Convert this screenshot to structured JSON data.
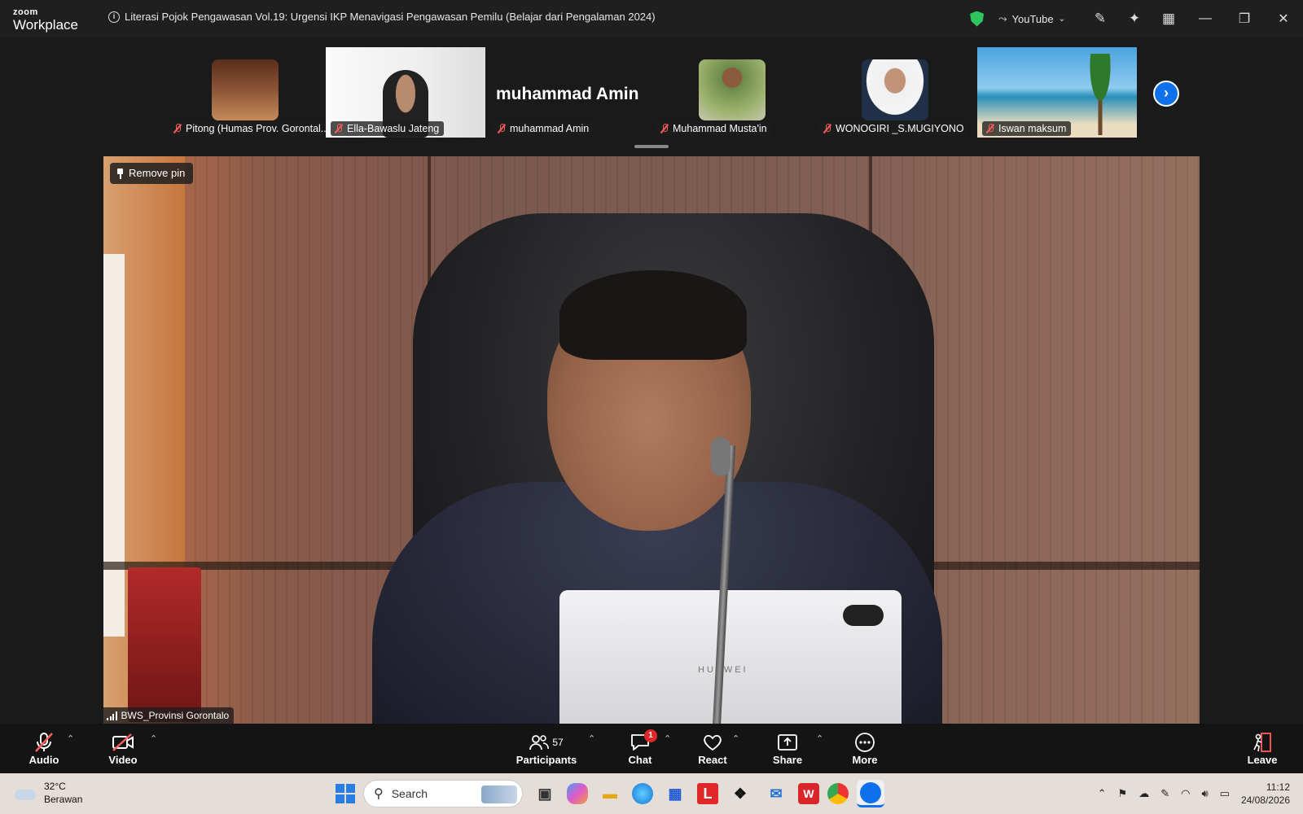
{
  "app": {
    "logo_small": "zoom",
    "logo_big": "Workplace"
  },
  "meeting": {
    "title": "Literasi Pojok Pengawasan Vol.19: Urgensi IKP Menavigasi Pengawasan Pemilu (Belajar  dari Pengalaman 2024)"
  },
  "titlebar": {
    "stream_label": "YouTube"
  },
  "participants_strip": [
    {
      "name": "Pitong (Humas Prov. Gorontal..."
    },
    {
      "name": "Ella-Bawaslu Jateng"
    },
    {
      "name": "muhammad Amin",
      "big_name": "muhammad Amin"
    },
    {
      "name": "Muhammad Musta'in"
    },
    {
      "name": "WONOGIRI _S.MUGIYONO"
    },
    {
      "name": "Iswan maksum"
    }
  ],
  "main_video": {
    "pin_label": "Remove pin",
    "speaker_name": "BWS_Provinsi Gorontalo",
    "device_brand": "HUAWEI"
  },
  "toolbar": {
    "audio": "Audio",
    "video": "Video",
    "participants": "Participants",
    "participants_count": "57",
    "chat": "Chat",
    "chat_badge": "1",
    "react": "React",
    "share": "Share",
    "more": "More",
    "leave": "Leave"
  },
  "taskbar": {
    "temperature": "32°C",
    "weather": "Berawan",
    "search_placeholder": "Search",
    "time": "11:12",
    "date": "24/08/2026"
  },
  "colors": {
    "accent": "#0e71eb",
    "shield": "#2fc55e",
    "muted": "#ff5c5c",
    "badge": "#e02828"
  }
}
